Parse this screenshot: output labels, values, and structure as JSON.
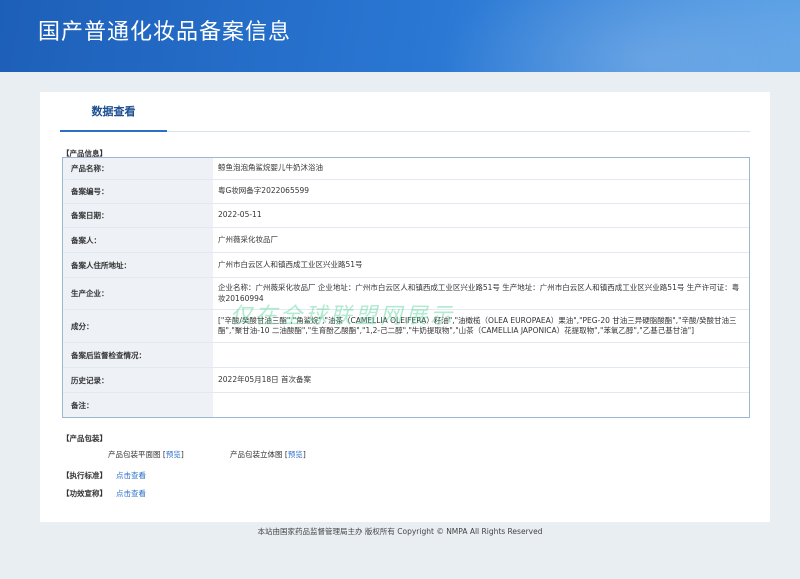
{
  "header": {
    "title": "国产普通化妆品备案信息"
  },
  "tab": {
    "label": "数据查看"
  },
  "sections": {
    "product_info": "【产品信息】",
    "product_package": "【产品包装】",
    "exec_standard": "【执行标准】",
    "efficacy": "【功效宣称】"
  },
  "rows": [
    {
      "label": "产品名称：",
      "value": "鲸鱼泡泡角鲨烷婴儿牛奶沐浴油"
    },
    {
      "label": "备案编号：",
      "value": "粤G妆网备字2022065599"
    },
    {
      "label": "备案日期：",
      "value": "2022-05-11"
    },
    {
      "label": "备案人：",
      "value": "广州薇采化妆品厂"
    },
    {
      "label": "备案人住所地址：",
      "value": "广州市白云区人和镇西成工业区兴业路51号"
    },
    {
      "label": "生产企业：",
      "value": "企业名称：广州薇采化妆品厂 企业地址：广州市白云区人和镇西成工业区兴业路51号 生产地址：广州市白云区人和镇西成工业区兴业路51号 生产许可证：粤妆20160994"
    },
    {
      "label": "成分：",
      "value": "[\"辛酸/癸酸甘油三酯\",\"角鲨烷\",\"油茶（CAMELLIA OLEIFERA）籽油\",\"油橄榄（OLEA EUROPAEA）果油\",\"PEG-20 甘油三异硬脂酸酯\",\"辛酸/癸酸甘油三酯\",\"聚甘油-10 二油酸酯\",\"生育酚乙酸酯\",\"1,2-己二醇\",\"牛奶提取物\",\"山茶（CAMELLIA JAPONICA）花提取物\",\"苯氧乙醇\",\"乙基己基甘油\"]"
    },
    {
      "label": "备案后监督检查情况：",
      "value": ""
    },
    {
      "label": "历史记录：",
      "value": "2022年05月18日 首次备案"
    },
    {
      "label": "备注：",
      "value": ""
    }
  ],
  "package": {
    "flat_label": "产品包装平面图",
    "stereo_label": "产品包装立体图",
    "preview_link": "预览"
  },
  "links": {
    "view": "点击查看"
  },
  "watermark": "仅在全球联盟网展示",
  "footer": "本站由国家药品监督管理局主办 版权所有 Copyright © NMPA All Rights Reserved"
}
